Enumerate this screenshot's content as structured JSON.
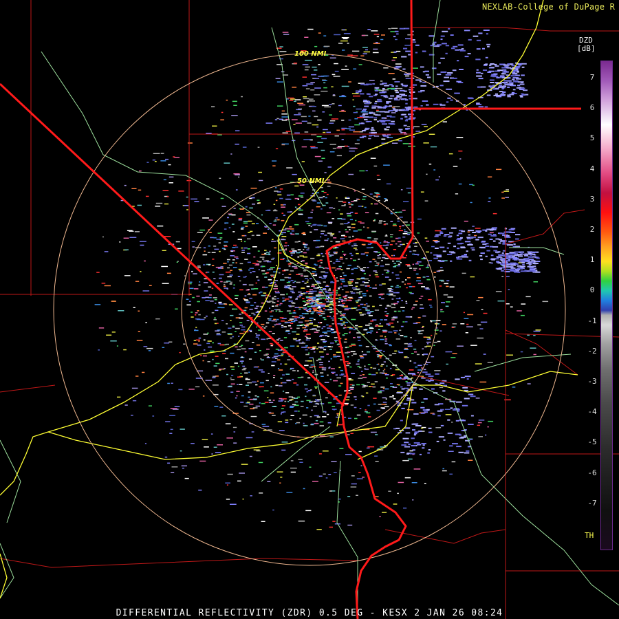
{
  "credit": "NEXLAB-College of DuPage R",
  "caption": "DIFFERENTIAL REFLECTIVITY (ZDR) 0.5 DEG - KESX 2 JAN 26 08:24",
  "range_rings": [
    {
      "label": "100 NMI"
    },
    {
      "label": "50 NMI"
    }
  ],
  "legend": {
    "title": "DZD",
    "unit": "[dB]",
    "ticks": [
      "7",
      "6",
      "5",
      "4",
      "3",
      "2",
      "1",
      "0",
      "-1",
      "-2",
      "-3",
      "-4",
      "-5",
      "-6",
      "-7"
    ],
    "threshold_label": "TH"
  },
  "colors": {
    "background": "#000000",
    "state_border": "#ff1a1a",
    "county_border": "#c01818",
    "highway": "#ffff33",
    "river": "#9de09d",
    "range_ring": "#f0b890",
    "ring_label": "#ffff40"
  }
}
